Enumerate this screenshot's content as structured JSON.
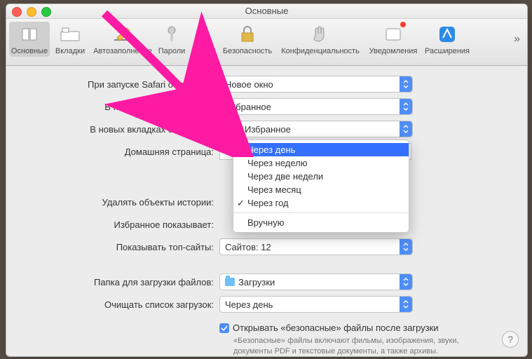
{
  "window": {
    "title": "Основные"
  },
  "toolbar": {
    "items": [
      {
        "label": "Основные"
      },
      {
        "label": "Вкладки"
      },
      {
        "label": "Автозаполнение"
      },
      {
        "label": "Пароли"
      },
      {
        "label": "Поиск"
      },
      {
        "label": "Безопасность"
      },
      {
        "label": "Конфиденциальность"
      },
      {
        "label": "Уведомления"
      },
      {
        "label": "Расширения"
      }
    ]
  },
  "form": {
    "launch_label": "При запуске Safari открывать:",
    "launch_value": "Новое окно",
    "new_windows_label": "В новых окнах открывать:",
    "new_windows_value": "Избранное",
    "new_tabs_label": "В новых вкладках открывать:",
    "new_tabs_value": "Избранное",
    "homepage_label": "Домашняя страница:",
    "homepage_value": "",
    "remove_history_label": "Удалять объекты истории:",
    "favorites_label": "Избранное показывает:",
    "topsites_label": "Показывать топ-сайты:",
    "topsites_value": "Сайтов: 12",
    "downloads_folder_label": "Папка для загрузки файлов:",
    "downloads_folder_value": "Загрузки",
    "clear_downloads_label": "Очищать список загрузок:",
    "clear_downloads_value": "Через день",
    "safe_open_label": "Открывать «безопасные» файлы после загрузки",
    "safe_open_hint": "«Безопасные» файлы включают фильмы, изображения, звуки, документы PDF и текстовые документы, а также архивы."
  },
  "dropdown": {
    "items": [
      {
        "label": "Через день",
        "selected": true
      },
      {
        "label": "Через неделю"
      },
      {
        "label": "Через две недели"
      },
      {
        "label": "Через месяц"
      },
      {
        "label": "Через год",
        "checked": true
      }
    ],
    "separator_after": 4,
    "tail": [
      {
        "label": "Вручную"
      }
    ]
  },
  "colors": {
    "accent": "#4f8ef7",
    "highlight": "#3470ff",
    "arrow": "#ff1aa3"
  }
}
